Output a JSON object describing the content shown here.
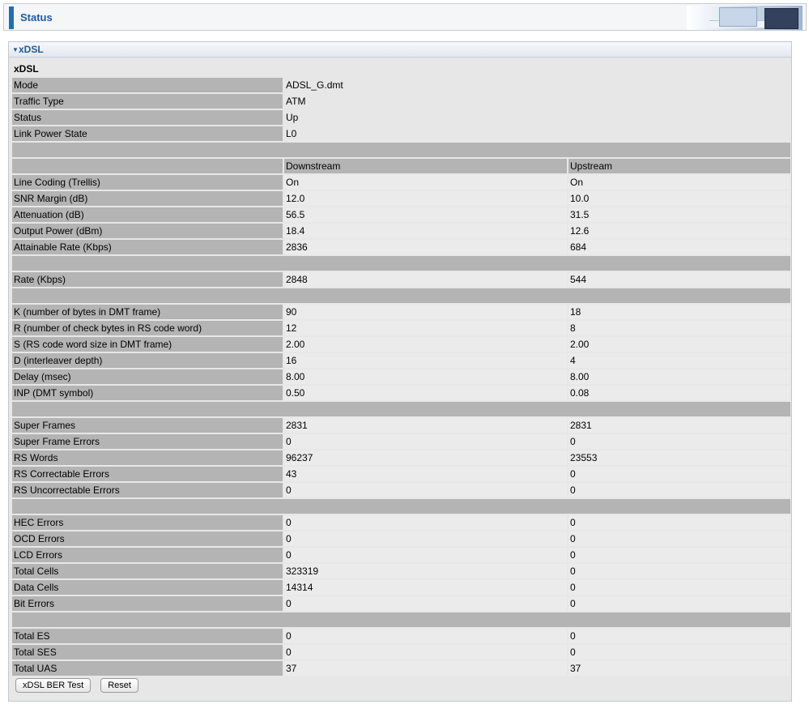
{
  "header": {
    "title": "Status"
  },
  "section": {
    "title": "xDSL"
  },
  "table": {
    "title": "xDSL",
    "rows": [
      {
        "type": "pair",
        "label": "Mode",
        "value": "ADSL_G.dmt"
      },
      {
        "type": "pair",
        "label": "Traffic Type",
        "value": "ATM"
      },
      {
        "type": "pair",
        "label": "Status",
        "value": "Up"
      },
      {
        "type": "pair",
        "label": "Link Power State",
        "value": "L0"
      },
      {
        "type": "sep"
      },
      {
        "type": "hdr",
        "label": "",
        "ds": "Downstream",
        "us": "Upstream"
      },
      {
        "type": "triple",
        "label": "Line Coding (Trellis)",
        "ds": "On",
        "us": "On"
      },
      {
        "type": "triple",
        "label": "SNR Margin (dB)",
        "ds": "12.0",
        "us": "10.0"
      },
      {
        "type": "triple",
        "label": "Attenuation (dB)",
        "ds": "56.5",
        "us": "31.5"
      },
      {
        "type": "triple",
        "label": "Output Power (dBm)",
        "ds": "18.4",
        "us": "12.6"
      },
      {
        "type": "triple",
        "label": "Attainable Rate (Kbps)",
        "ds": "2836",
        "us": "684"
      },
      {
        "type": "sep"
      },
      {
        "type": "triple",
        "label": "Rate (Kbps)",
        "ds": "2848",
        "us": "544"
      },
      {
        "type": "sep"
      },
      {
        "type": "triple",
        "label": "K (number of bytes in DMT frame)",
        "ds": "90",
        "us": "18"
      },
      {
        "type": "triple",
        "label": "R (number of check bytes in RS code word)",
        "ds": "12",
        "us": "8"
      },
      {
        "type": "triple",
        "label": "S (RS code word size in DMT frame)",
        "ds": "2.00",
        "us": "2.00"
      },
      {
        "type": "triple",
        "label": "D (interleaver depth)",
        "ds": "16",
        "us": "4"
      },
      {
        "type": "triple",
        "label": "Delay (msec)",
        "ds": "8.00",
        "us": "8.00"
      },
      {
        "type": "triple",
        "label": "INP (DMT symbol)",
        "ds": "0.50",
        "us": "0.08"
      },
      {
        "type": "sep"
      },
      {
        "type": "triple",
        "label": "Super Frames",
        "ds": "2831",
        "us": "2831"
      },
      {
        "type": "triple",
        "label": "Super Frame Errors",
        "ds": "0",
        "us": "0"
      },
      {
        "type": "triple",
        "label": "RS Words",
        "ds": "96237",
        "us": "23553"
      },
      {
        "type": "triple",
        "label": "RS Correctable Errors",
        "ds": "43",
        "us": "0"
      },
      {
        "type": "triple",
        "label": "RS Uncorrectable Errors",
        "ds": "0",
        "us": "0"
      },
      {
        "type": "sep"
      },
      {
        "type": "triple",
        "label": "HEC Errors",
        "ds": "0",
        "us": "0"
      },
      {
        "type": "triple",
        "label": "OCD Errors",
        "ds": "0",
        "us": "0"
      },
      {
        "type": "triple",
        "label": "LCD Errors",
        "ds": "0",
        "us": "0"
      },
      {
        "type": "triple",
        "label": "Total Cells",
        "ds": "323319",
        "us": "0"
      },
      {
        "type": "triple",
        "label": "Data Cells",
        "ds": "14314",
        "us": "0"
      },
      {
        "type": "triple",
        "label": "Bit Errors",
        "ds": "0",
        "us": "0"
      },
      {
        "type": "sep"
      },
      {
        "type": "triple",
        "label": "Total ES",
        "ds": "0",
        "us": "0"
      },
      {
        "type": "triple",
        "label": "Total SES",
        "ds": "0",
        "us": "0"
      },
      {
        "type": "triple",
        "label": "Total UAS",
        "ds": "37",
        "us": "37"
      }
    ]
  },
  "buttons": {
    "ber_test": "xDSL BER Test",
    "reset": "Reset"
  }
}
